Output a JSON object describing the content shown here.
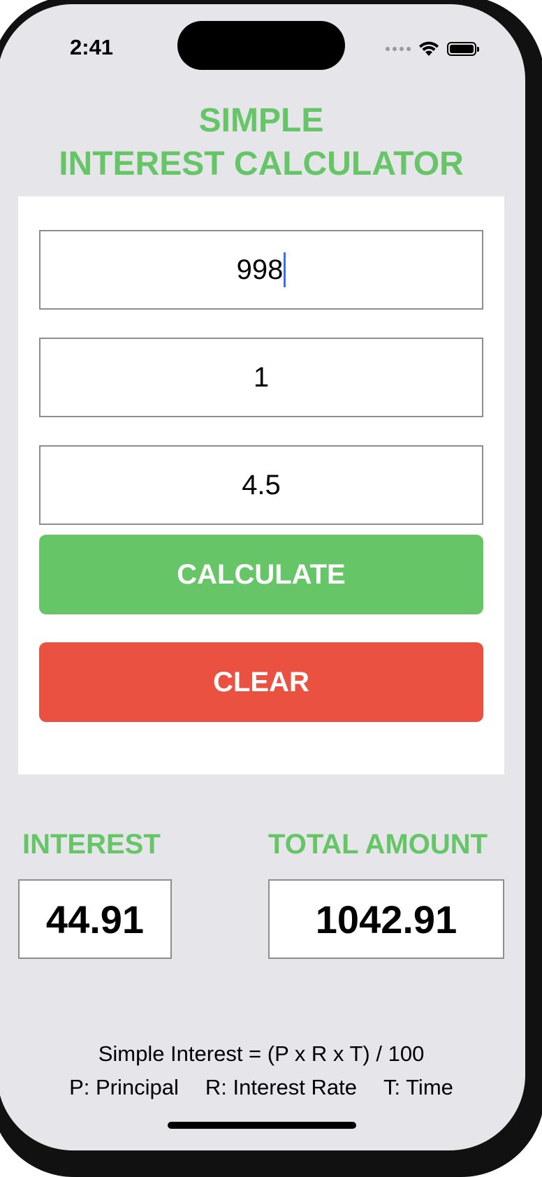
{
  "status_bar": {
    "time": "2:41"
  },
  "title": {
    "line1": "SIMPLE",
    "line2": "INTEREST CALCULATOR"
  },
  "inputs": {
    "principal_value": "998",
    "time_value": "1",
    "rate_value": "4.5"
  },
  "buttons": {
    "calculate_label": "CALCULATE",
    "clear_label": "CLEAR"
  },
  "results": {
    "interest_label": "INTEREST",
    "interest_value": "44.91",
    "total_label": "TOTAL AMOUNT",
    "total_value": "1042.91"
  },
  "footer": {
    "formula": "Simple Interest = (P x R x T) / 100",
    "legend_p": "P: Principal",
    "legend_r": "R: Interest Rate",
    "legend_t": "T: Time"
  },
  "colors": {
    "accent_green": "#66c667",
    "clear_red": "#ea5140",
    "background": "#e5e5ea"
  }
}
